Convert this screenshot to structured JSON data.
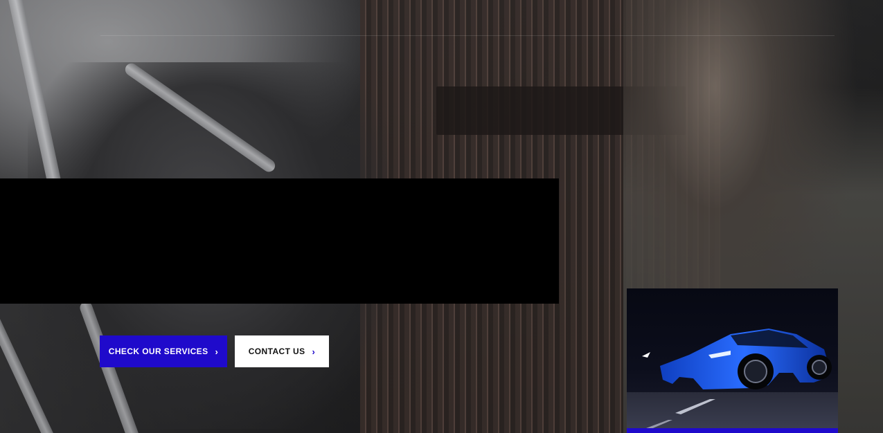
{
  "hero": {
    "primary_button_label": "CHECK OUR SERVICES",
    "secondary_button_label": "CONTACT US",
    "chevron_icon": "chevron-right-icon"
  },
  "colors": {
    "accent": "#1f0acb",
    "secondary_button_bg": "#ffffff",
    "redacted_block": "#000000"
  },
  "featured_card": {
    "image": "blue sports car at night"
  }
}
